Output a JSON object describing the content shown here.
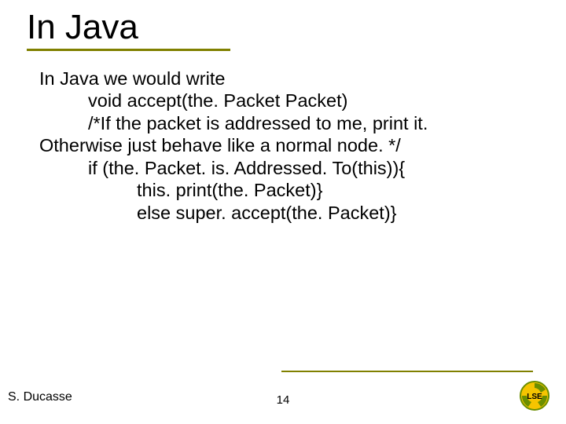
{
  "title": "In Java",
  "body": {
    "intro": "In Java we would write",
    "l1": "void accept(the. Packet Packet)",
    "l2": "/*If the packet is addressed to me, print it.",
    "l3": "Otherwise just behave like a normal node. */",
    "l4": "if (the. Packet. is. Addressed. To(this)){",
    "l5": "this. print(the. Packet)}",
    "l6": "else super. accept(the. Packet)}"
  },
  "author": "S. Ducasse",
  "page": "14",
  "logo_text": "LSE"
}
